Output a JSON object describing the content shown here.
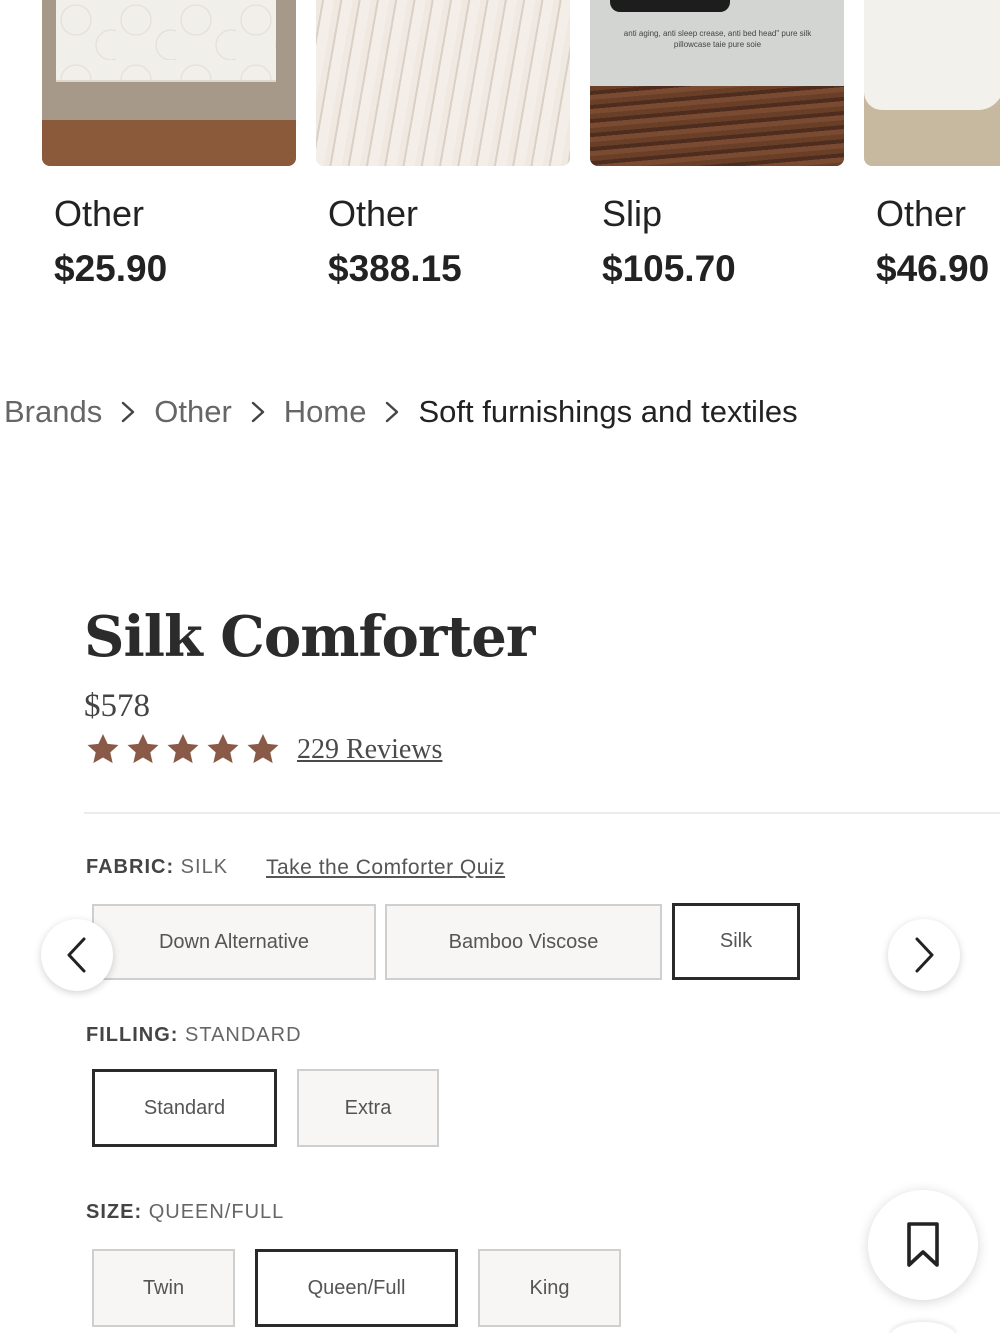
{
  "recommendations": [
    {
      "brand": "Other",
      "price": "$25.90",
      "image": "quilt-photo"
    },
    {
      "brand": "Other",
      "price": "$388.15",
      "image": "linen-sheets-photo"
    },
    {
      "brand": "Slip",
      "price": "$105.70",
      "image": "silk-pillowcase-box-photo",
      "box_text": "anti aging, anti sleep crease, anti bed head\" pure silk pillowcase   taie pure soie"
    },
    {
      "brand": "Other",
      "price": "$46.90",
      "image": "pillow-photo"
    }
  ],
  "breadcrumb": {
    "items": [
      "Brands",
      "Other",
      "Home"
    ],
    "current": "Soft furnishings and textiles",
    "separator_icon": "chevron-right-icon"
  },
  "product": {
    "title": "Silk Comforter",
    "price": "$578",
    "rating": 5,
    "rating_max": 5,
    "star_color": "#8a5a48",
    "reviews": "229 Reviews",
    "fabric": {
      "key": "FABRIC:",
      "value": "SILK",
      "quiz_link": "Take the Comforter Quiz",
      "options": [
        "Down Alternative",
        "Bamboo Viscose",
        "Silk"
      ],
      "selected": "Silk"
    },
    "filling": {
      "key": "FILLING:",
      "value": "STANDARD",
      "options": [
        "Standard",
        "Extra"
      ],
      "selected": "Standard"
    },
    "size": {
      "key": "SIZE:",
      "value": "QUEEN/FULL",
      "options": [
        "Twin",
        "Queen/Full",
        "King"
      ],
      "selected": "Queen/Full"
    }
  },
  "controls": {
    "prev_icon": "chevron-left-icon",
    "next_icon": "chevron-right-icon",
    "save_icon": "bookmark-icon"
  }
}
